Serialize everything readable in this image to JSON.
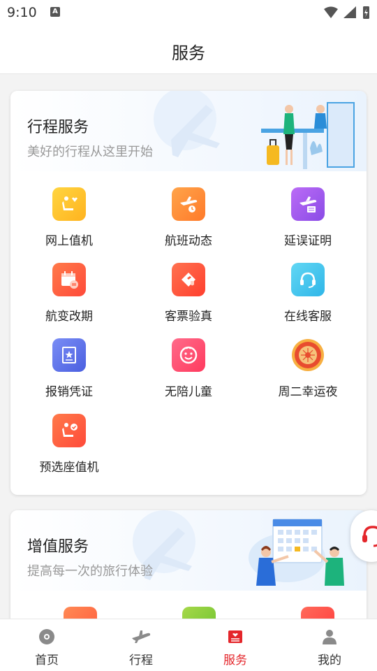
{
  "status": {
    "time": "9:10",
    "notif_icon": "A"
  },
  "header": {
    "title": "服务"
  },
  "trip_section": {
    "title": "行程服务",
    "subtitle": "美好的行程从这里开始",
    "items": [
      {
        "label": "网上值机",
        "icon": "checkin-seat-icon",
        "color": "#ffc52e"
      },
      {
        "label": "航班动态",
        "icon": "flight-status-icon",
        "color": "#ff8a33"
      },
      {
        "label": "延误证明",
        "icon": "delay-proof-icon",
        "color": "#a45cf0"
      },
      {
        "label": "航变改期",
        "icon": "calendar-change-icon",
        "color": "#ff5a3c"
      },
      {
        "label": "客票验真",
        "icon": "ticket-verify-icon",
        "color": "#ff5535"
      },
      {
        "label": "在线客服",
        "icon": "headset-icon",
        "color": "#45c7ef"
      },
      {
        "label": "报销凭证",
        "icon": "receipt-icon",
        "color": "#5b72ea"
      },
      {
        "label": "无陪儿童",
        "icon": "child-face-icon",
        "color": "#ff4a6e"
      },
      {
        "label": "周二幸运夜",
        "icon": "lucky-tuesday-icon",
        "color": "#e84c2f"
      },
      {
        "label": "预选座值机",
        "icon": "seat-select-icon",
        "color": "#ff5a3c"
      }
    ]
  },
  "value_section": {
    "title": "增值服务",
    "subtitle": "提高每一次的旅行体验"
  },
  "tabs": [
    {
      "label": "首页",
      "icon": "home-icon",
      "active": false
    },
    {
      "label": "行程",
      "icon": "plane-icon",
      "active": false
    },
    {
      "label": "服务",
      "icon": "service-icon",
      "active": true
    },
    {
      "label": "我的",
      "icon": "profile-icon",
      "active": false
    }
  ],
  "accent_color": "#e4262b"
}
